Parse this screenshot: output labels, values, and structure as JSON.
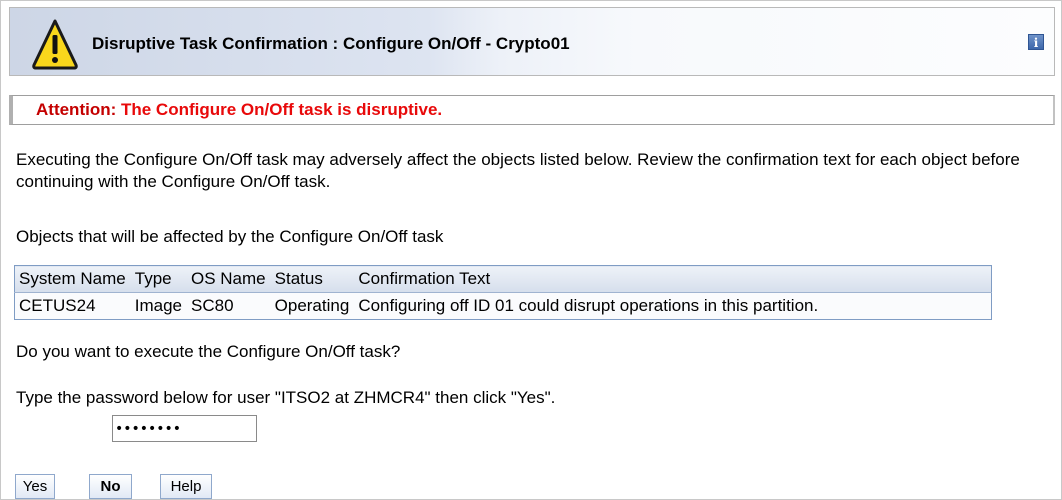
{
  "header": {
    "title": "Disruptive Task Confirmation : Configure On/Off - Crypto01",
    "warning_icon": "warning-triangle-icon",
    "info_icon": "info-icon",
    "info_label": "i"
  },
  "attention": {
    "text": "Attention: The Configure On/Off task is disruptive.",
    "color": "#e8090a"
  },
  "intro_text": "Executing the Configure On/Off task may adversely affect the objects listed below. Review the confirmation text for each object before continuing with the Configure On/Off task.",
  "objects_label": "Objects that will be affected by the Configure On/Off task",
  "table": {
    "columns": [
      "System Name",
      "Type",
      "OS Name",
      "Status",
      "Confirmation Text"
    ],
    "rows": [
      [
        "CETUS24",
        "Image",
        "SC80",
        "Operating",
        "Configuring off ID 01 could disrupt operations in this partition."
      ]
    ]
  },
  "question": "Do you want to execute the Configure On/Off task?",
  "password_prompt": "Type the password below for user \"ITSO2 at ZHMCR4\" then click \"Yes\".",
  "password": {
    "value": "••••••••"
  },
  "buttons": {
    "yes": "Yes",
    "no": "No",
    "help": "Help"
  }
}
